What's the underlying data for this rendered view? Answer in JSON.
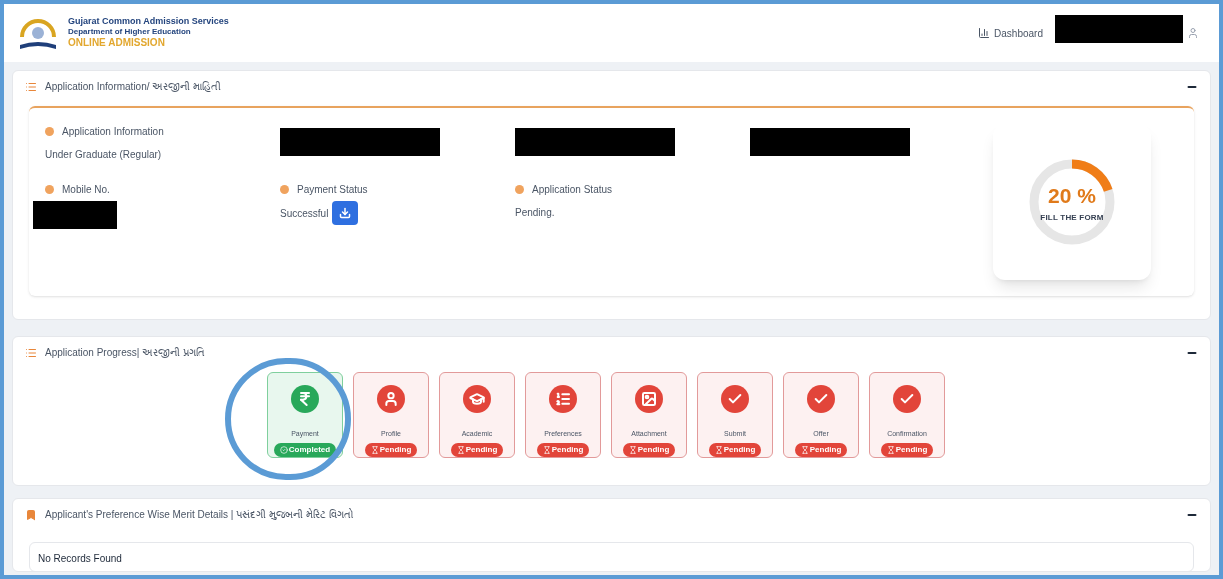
{
  "header": {
    "title": "Gujarat Common Admission Services",
    "subtitle": "Department of Higher Education",
    "brand": "ONLINE ADMISSION",
    "dashboard_link": "Dashboard"
  },
  "application_info": {
    "title": "Application Information/ અરજીની માહિતી",
    "fields": [
      {
        "kind": "text",
        "label": "Application Information",
        "value": "Under Graduate (Regular)"
      },
      {
        "kind": "redacted"
      },
      {
        "kind": "redacted"
      },
      {
        "kind": "redacted"
      },
      {
        "kind": "redacted_value",
        "label": "Mobile No."
      },
      {
        "kind": "download",
        "label": "Payment Status",
        "value": "Successful"
      },
      {
        "kind": "text",
        "label": "Application Status",
        "value": "Pending."
      }
    ],
    "progress": {
      "level": 0.2,
      "reading": "20 %",
      "caption": "FILL THE FORM"
    }
  },
  "application_progress": {
    "title": "Application Progress| અરજીની પ્રગતિ",
    "steps": [
      {
        "kind": "payment",
        "label": "Payment",
        "status": "Completed",
        "completed": true,
        "highlighted": true
      },
      {
        "kind": "profile",
        "label": "Profile",
        "status": "Pending",
        "completed": false,
        "highlighted": false
      },
      {
        "kind": "academic",
        "label": "Academic",
        "status": "Pending",
        "completed": false,
        "highlighted": false
      },
      {
        "kind": "list",
        "label": "Preferences",
        "status": "Pending",
        "completed": false,
        "highlighted": false
      },
      {
        "kind": "image",
        "label": "Attachment",
        "status": "Pending",
        "completed": false,
        "highlighted": false
      },
      {
        "kind": "check",
        "label": "Submit",
        "status": "Pending",
        "completed": false,
        "highlighted": false
      },
      {
        "kind": "check",
        "label": "Offer",
        "status": "Pending",
        "completed": false,
        "highlighted": false
      },
      {
        "kind": "check",
        "label": "Confirmation",
        "status": "Pending",
        "completed": false,
        "highlighted": false
      }
    ]
  },
  "merit": {
    "title": "Applicant's Preference Wise Merit Details | પસંદગી મુજબની મેરિટ વિગતો",
    "message": "No Records Found"
  }
}
